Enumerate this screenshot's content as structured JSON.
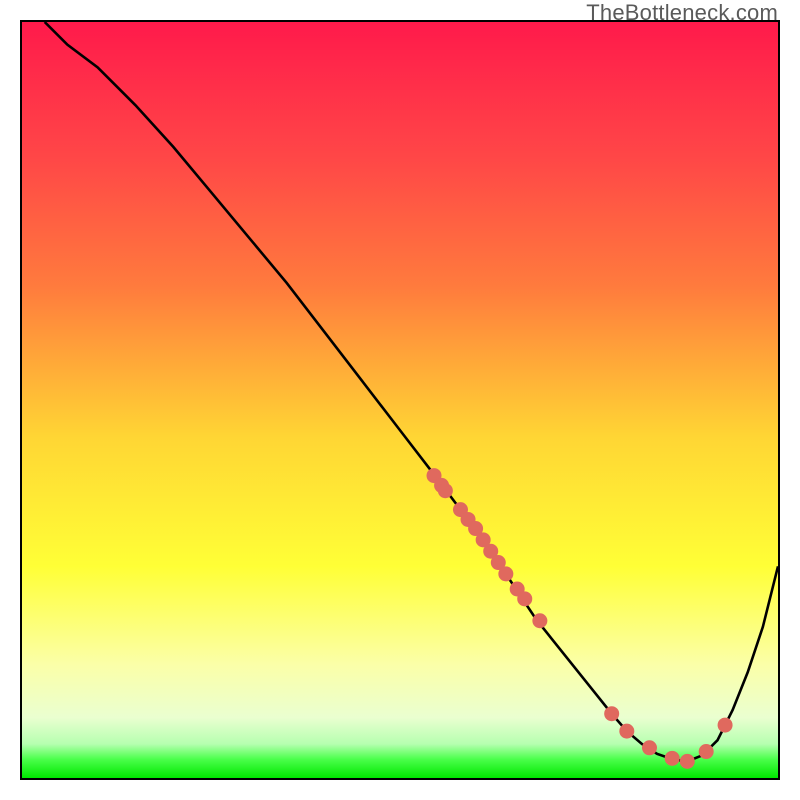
{
  "watermark": "TheBottleneck.com",
  "chart_data": {
    "type": "line",
    "title": "",
    "xlabel": "",
    "ylabel": "",
    "xlim": [
      0,
      100
    ],
    "ylim": [
      0,
      100
    ],
    "grid": false,
    "legend": false,
    "curve": {
      "x": [
        3,
        6,
        10,
        15,
        20,
        25,
        30,
        35,
        40,
        45,
        50,
        54,
        55,
        58,
        60,
        62,
        64,
        66,
        68,
        70,
        72,
        74,
        76,
        78,
        80,
        82,
        84,
        86,
        88,
        90,
        92,
        94,
        96,
        98,
        100
      ],
      "y": [
        100,
        97,
        94,
        89,
        83.5,
        77.5,
        71.5,
        65.5,
        59,
        52.5,
        46,
        40.8,
        39.5,
        35.5,
        33,
        30,
        27,
        24,
        21,
        18.5,
        16,
        13.5,
        11,
        8.5,
        6.2,
        4.5,
        3.2,
        2.5,
        2.2,
        3,
        5,
        9,
        14,
        20,
        28
      ]
    },
    "points": {
      "x": [
        54.5,
        55.5,
        56,
        58,
        59,
        60,
        61,
        62,
        63,
        64,
        65.5,
        66.5,
        68.5,
        78,
        80,
        83,
        86,
        88,
        90.5,
        93
      ],
      "y": [
        40,
        38.7,
        38,
        35.5,
        34.2,
        33,
        31.5,
        30,
        28.5,
        27,
        25,
        23.7,
        20.8,
        8.5,
        6.2,
        4,
        2.6,
        2.2,
        3.5,
        7
      ]
    },
    "green_band": {
      "y_min": 0,
      "y_max": 3.5
    },
    "colors": {
      "curve": "#000000",
      "points": "#e0695e",
      "green": "#00e800",
      "gradient_stops": [
        {
          "offset": 0.0,
          "color": "#ff1a4b"
        },
        {
          "offset": 0.18,
          "color": "#ff4747"
        },
        {
          "offset": 0.35,
          "color": "#ff7b3d"
        },
        {
          "offset": 0.55,
          "color": "#ffd634"
        },
        {
          "offset": 0.72,
          "color": "#ffff36"
        },
        {
          "offset": 0.85,
          "color": "#fbffa8"
        },
        {
          "offset": 0.92,
          "color": "#eaffd0"
        },
        {
          "offset": 0.955,
          "color": "#b6ffb0"
        },
        {
          "offset": 0.975,
          "color": "#4cff4c"
        },
        {
          "offset": 1.0,
          "color": "#00e800"
        }
      ]
    }
  }
}
